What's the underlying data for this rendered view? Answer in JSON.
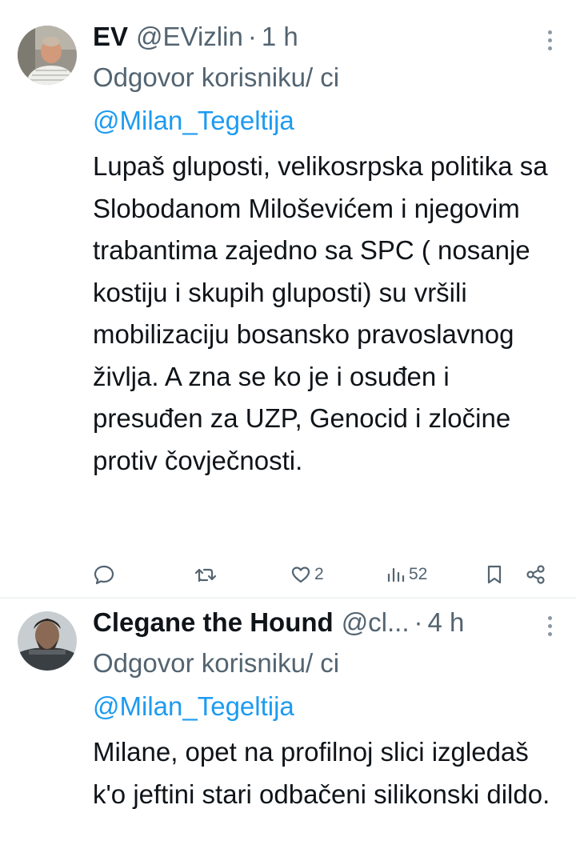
{
  "tweets": [
    {
      "name": "EV",
      "handle": "@EVizlin",
      "separator": "·",
      "time": "1 h",
      "reply_prefix": "Odgovor korisniku/ ci ",
      "reply_mention": "@Milan_Tegeltija",
      "body": "Lupaš gluposti, velikosrpska politika sa Slobodanom Miloševićem i njegovim trabantima zajedno sa SPC ( nosanje kostiju i skupih gluposti) su vršili mobilizaciju bosansko pravoslavnog življa. A zna se ko je i osuđen i presuđen za UZP, Genocid i zločine protiv čovječnosti.",
      "actions": {
        "reply_icon": "reply-icon",
        "retweet_icon": "retweet-icon",
        "like_icon": "like-icon",
        "like_count": "2",
        "views_icon": "views-icon",
        "view_count": "52",
        "bookmark_icon": "bookmark-icon",
        "share_icon": "share-icon"
      }
    },
    {
      "name": "Clegane the Hound",
      "handle": "@cl...",
      "separator": "·",
      "time": "4 h",
      "reply_prefix": "Odgovor korisniku/ ci ",
      "reply_mention": "@Milan_Tegeltija",
      "body": "Milane, opet na profilnoj slici izgledaš k'o jeftini stari odbačeni silikonski dildo."
    }
  ],
  "colors": {
    "text": "#0f1419",
    "secondary": "#536471",
    "link": "#1d9bf0",
    "divider": "#eff3f4"
  },
  "icons": {
    "more": "more-dots-icon"
  }
}
